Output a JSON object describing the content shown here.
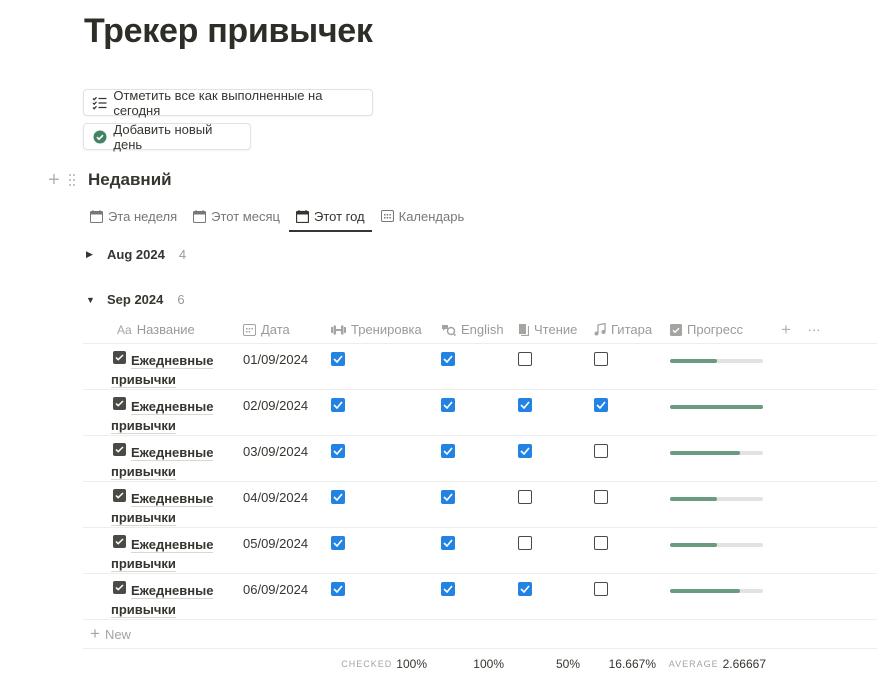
{
  "page": {
    "title": "Трекер привычек"
  },
  "buttons": {
    "mark_all": "Отметить все как выполненные на сегодня",
    "add_day": "Добавить новый день"
  },
  "section": {
    "title": "Недавний"
  },
  "tabs": [
    {
      "label": "Эта неделя",
      "icon": "calendar-icon",
      "active": false
    },
    {
      "label": "Этот месяц",
      "icon": "calendar-icon",
      "active": false
    },
    {
      "label": "Этот год",
      "icon": "calendar-icon",
      "active": true
    },
    {
      "label": "Календарь",
      "icon": "calendar-grid-icon",
      "active": false
    }
  ],
  "groups": [
    {
      "name": "Aug 2024",
      "count": "4",
      "expanded": false
    },
    {
      "name": "Sep 2024",
      "count": "6",
      "expanded": true
    }
  ],
  "table": {
    "columns": [
      {
        "key": "name",
        "label": "Название",
        "icon": "text-icon",
        "icon_text": "Aa"
      },
      {
        "key": "date",
        "label": "Дата",
        "icon": "calendar-icon"
      },
      {
        "key": "training",
        "label": "Тренировка",
        "icon": "dumbbell-icon"
      },
      {
        "key": "english",
        "label": "English",
        "icon": "translate-icon"
      },
      {
        "key": "reading",
        "label": "Чтение",
        "icon": "book-icon"
      },
      {
        "key": "guitar",
        "label": "Гитара",
        "icon": "music-note-icon"
      },
      {
        "key": "progress",
        "label": "Прогресс",
        "icon": "checkbox-icon"
      }
    ],
    "rows": [
      {
        "name": "Ежедневные привычки",
        "date": "01/09/2024",
        "training": true,
        "english": true,
        "reading": false,
        "guitar": false,
        "progress": 0.5
      },
      {
        "name": "Ежедневные привычки",
        "date": "02/09/2024",
        "training": true,
        "english": true,
        "reading": true,
        "guitar": true,
        "progress": 1.0
      },
      {
        "name": "Ежедневные привычки",
        "date": "03/09/2024",
        "training": true,
        "english": true,
        "reading": true,
        "guitar": false,
        "progress": 0.75
      },
      {
        "name": "Ежедневные привычки",
        "date": "04/09/2024",
        "training": true,
        "english": true,
        "reading": false,
        "guitar": false,
        "progress": 0.5
      },
      {
        "name": "Ежедневные привычки",
        "date": "05/09/2024",
        "training": true,
        "english": true,
        "reading": false,
        "guitar": false,
        "progress": 0.5
      },
      {
        "name": "Ежедневные привычки",
        "date": "06/09/2024",
        "training": true,
        "english": true,
        "reading": true,
        "guitar": false,
        "progress": 0.75
      }
    ],
    "new_label": "New",
    "calculations": {
      "training_label": "CHECKED",
      "training": "100%",
      "english": "100%",
      "reading": "50%",
      "guitar": "16.667%",
      "progress_label": "AVERAGE",
      "progress": "2.66667"
    }
  },
  "colors": {
    "checkbox_on": "#2383e2",
    "progress_fill": "#6b9b7e",
    "progress_track": "#e3e2e0",
    "add_day_icon": "#448361"
  }
}
